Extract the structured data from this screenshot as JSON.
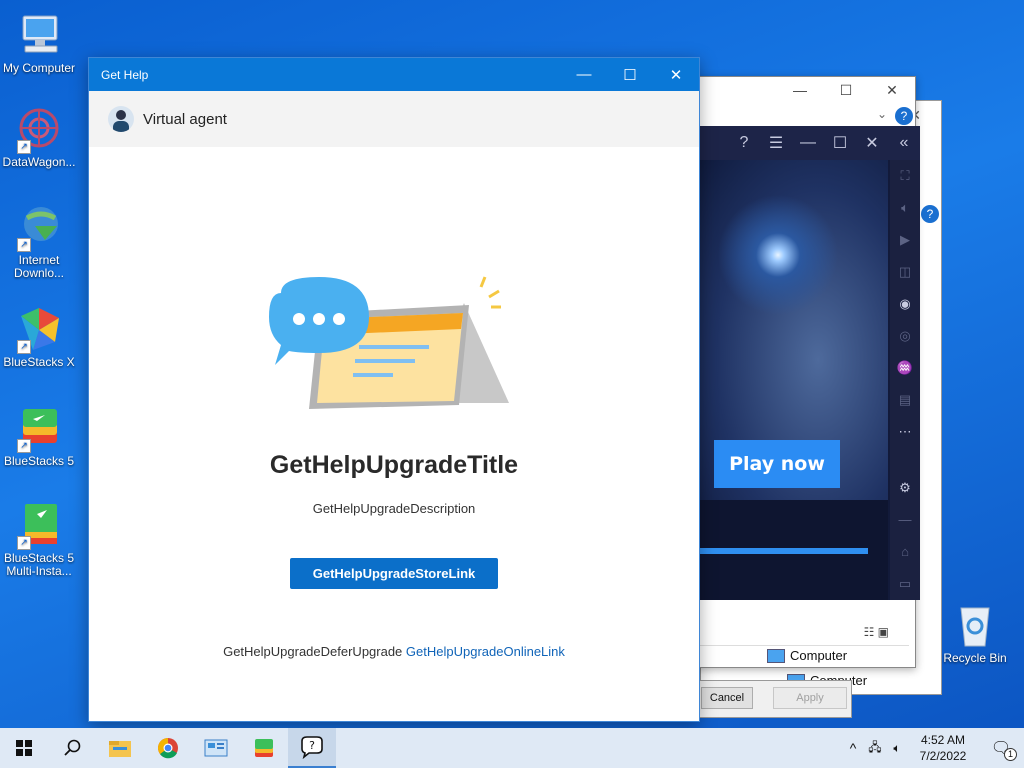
{
  "desktop": {
    "icons": [
      {
        "label": "My Computer"
      },
      {
        "label": "DataWagon..."
      },
      {
        "label": "Internet Downlo..."
      },
      {
        "label": "BlueStacks X"
      },
      {
        "label": "BlueStacks 5"
      },
      {
        "label": "BlueStacks 5 Multi-Insta..."
      },
      {
        "label": "Recycle Bin"
      }
    ]
  },
  "background_windows": {
    "explorer_status_1": "Computer",
    "explorer_status_2": "Computer",
    "cancel_label": "Cancel",
    "apply_label": "Apply"
  },
  "bluestacks": {
    "play_now_label": "Play now"
  },
  "get_help": {
    "window_title": "Get Help",
    "agent_label": "Virtual agent",
    "heading": "GetHelpUpgradeTitle",
    "description": "GetHelpUpgradeDescription",
    "store_link_label": "GetHelpUpgradeStoreLink",
    "defer_text": "GetHelpUpgradeDeferUpgrade",
    "online_link_label": "GetHelpUpgradeOnlineLink"
  },
  "taskbar": {
    "time": "4:52 AM",
    "date": "7/2/2022",
    "notification_count": "1"
  },
  "colors": {
    "accent": "#0a78d7",
    "button": "#0b6fc9",
    "link": "#1064b8"
  }
}
